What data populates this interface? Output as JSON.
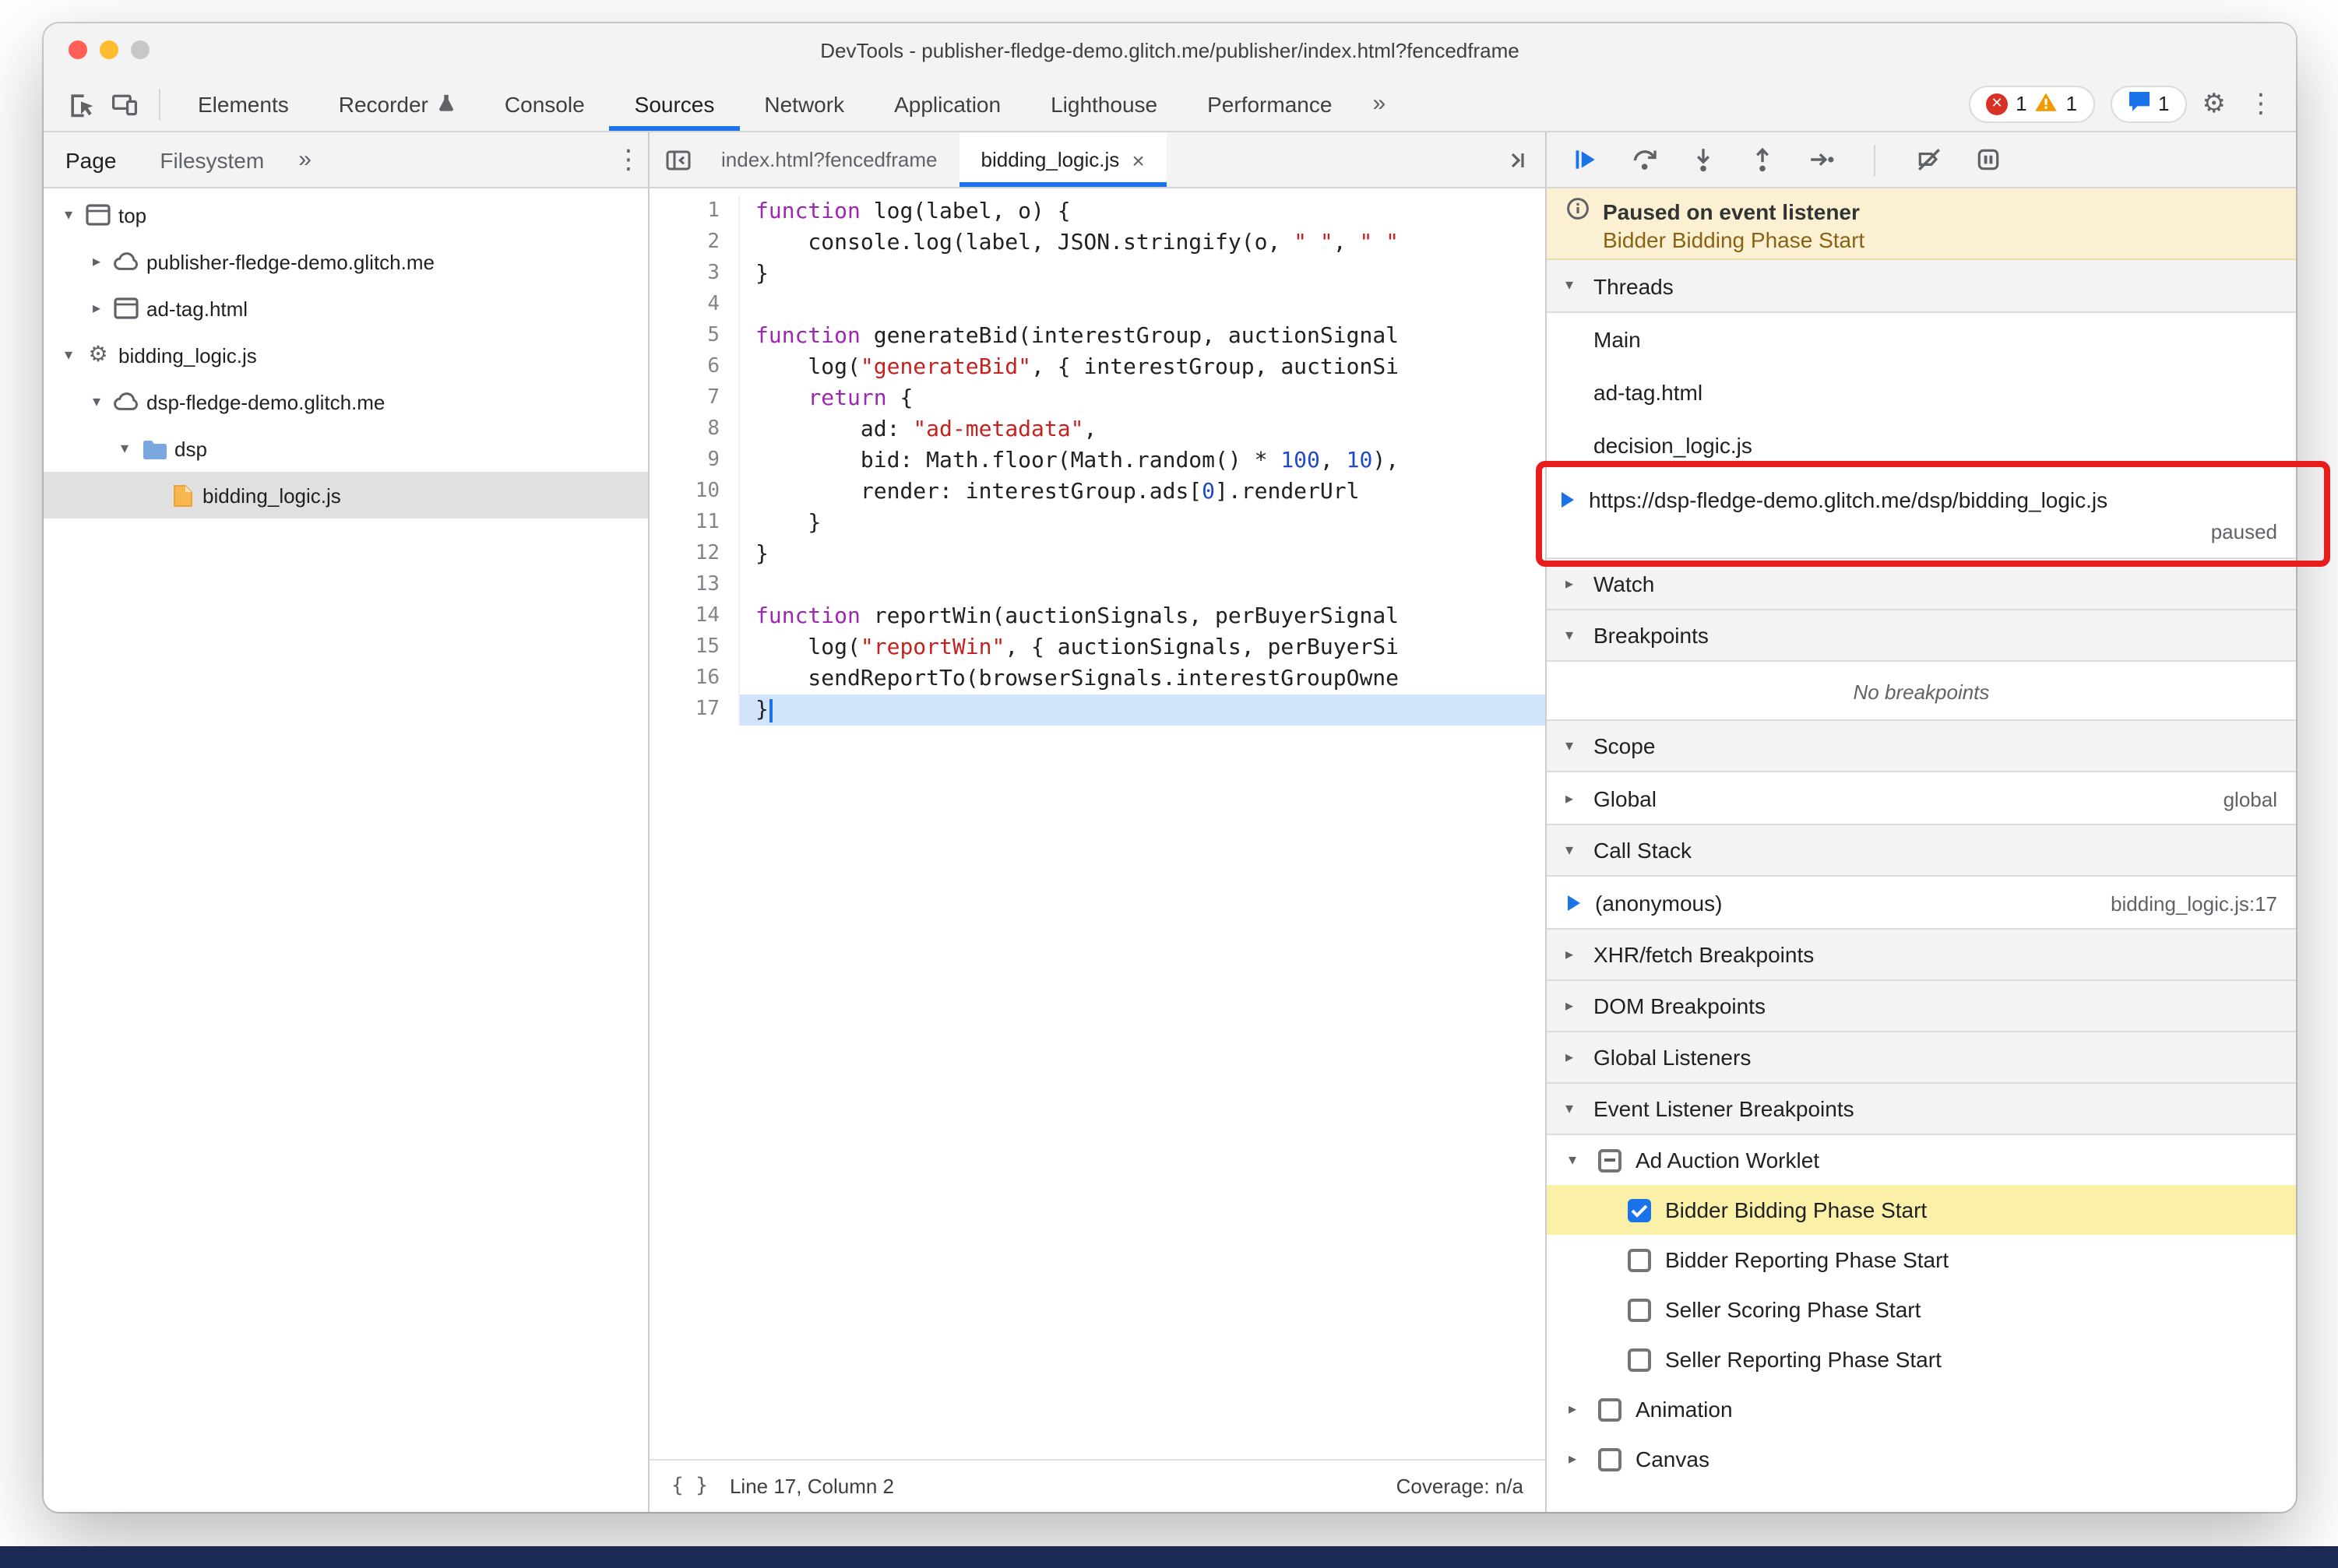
{
  "window": {
    "title": "DevTools - publisher-fledge-demo.glitch.me/publisher/index.html?fencedframe",
    "traffic_lights": [
      "#ff5f57",
      "#febc2e",
      "#c7c7c7"
    ]
  },
  "main_toolbar": {
    "tabs": [
      {
        "label": "Elements",
        "active": false
      },
      {
        "label": "Recorder",
        "active": false,
        "has_flask_icon": true
      },
      {
        "label": "Console",
        "active": false
      },
      {
        "label": "Sources",
        "active": true
      },
      {
        "label": "Network",
        "active": false
      },
      {
        "label": "Application",
        "active": false
      },
      {
        "label": "Lighthouse",
        "active": false
      },
      {
        "label": "Performance",
        "active": false
      }
    ],
    "more_tabs_chevron": "»",
    "badges": {
      "errors": "1",
      "warnings": "1",
      "issues": "1"
    }
  },
  "navigator": {
    "tabs": [
      {
        "label": "Page",
        "active": true
      },
      {
        "label": "Filesystem",
        "active": false
      }
    ],
    "more_tabs_chevron": "»",
    "tree": [
      {
        "label": "top",
        "depth": 0,
        "state": "expanded",
        "icon": "frame-icon"
      },
      {
        "label": "publisher-fledge-demo.glitch.me",
        "depth": 1,
        "state": "collapsed",
        "icon": "cloud-icon"
      },
      {
        "label": "ad-tag.html",
        "depth": 1,
        "state": "collapsed",
        "icon": "frame-icon"
      },
      {
        "label": "bidding_logic.js",
        "depth": 0,
        "state": "expanded",
        "icon": "worklet-gear-icon"
      },
      {
        "label": "dsp-fledge-demo.glitch.me",
        "depth": 1,
        "state": "expanded",
        "icon": "cloud-icon"
      },
      {
        "label": "dsp",
        "depth": 2,
        "state": "expanded",
        "icon": "folder-icon"
      },
      {
        "label": "bidding_logic.js",
        "depth": 3,
        "state": "leaf",
        "icon": "js-file-icon",
        "selected": true
      }
    ]
  },
  "editor": {
    "tabs": [
      {
        "label": "index.html?fencedframe",
        "active": false
      },
      {
        "label": "bidding_logic.js",
        "active": true,
        "close_glyph": "×"
      }
    ],
    "paused_line": 17,
    "code": [
      {
        "n": 1,
        "tokens": [
          [
            "kw",
            "function"
          ],
          [
            "pl",
            " log(label, o) {"
          ]
        ]
      },
      {
        "n": 2,
        "tokens": [
          [
            "pl",
            "    console.log(label, JSON.stringify(o, "
          ],
          [
            "str",
            "\" \""
          ],
          [
            "pl",
            ", "
          ],
          [
            "str",
            "\" \""
          ]
        ]
      },
      {
        "n": 3,
        "tokens": [
          [
            "pl",
            "}"
          ]
        ]
      },
      {
        "n": 4,
        "tokens": []
      },
      {
        "n": 5,
        "tokens": [
          [
            "kw",
            "function"
          ],
          [
            "pl",
            " generateBid(interestGroup, auctionSignal"
          ]
        ]
      },
      {
        "n": 6,
        "tokens": [
          [
            "pl",
            "    log("
          ],
          [
            "str",
            "\"generateBid\""
          ],
          [
            "pl",
            ", { interestGroup, auctionSi"
          ]
        ]
      },
      {
        "n": 7,
        "tokens": [
          [
            "pl",
            "    "
          ],
          [
            "kw",
            "return"
          ],
          [
            "pl",
            " {"
          ]
        ]
      },
      {
        "n": 8,
        "tokens": [
          [
            "pl",
            "        ad: "
          ],
          [
            "str",
            "\"ad-metadata\""
          ],
          [
            "pl",
            ","
          ]
        ]
      },
      {
        "n": 9,
        "tokens": [
          [
            "pl",
            "        bid: Math.floor(Math.random() * "
          ],
          [
            "num",
            "100"
          ],
          [
            "pl",
            ", "
          ],
          [
            "num",
            "10"
          ],
          [
            "pl",
            "),"
          ]
        ]
      },
      {
        "n": 10,
        "tokens": [
          [
            "pl",
            "        render: interestGroup.ads["
          ],
          [
            "num",
            "0"
          ],
          [
            "pl",
            "].renderUrl"
          ]
        ]
      },
      {
        "n": 11,
        "tokens": [
          [
            "pl",
            "    }"
          ]
        ]
      },
      {
        "n": 12,
        "tokens": [
          [
            "pl",
            "}"
          ]
        ]
      },
      {
        "n": 13,
        "tokens": []
      },
      {
        "n": 14,
        "tokens": [
          [
            "kw",
            "function"
          ],
          [
            "pl",
            " reportWin(auctionSignals, perBuyerSignal"
          ]
        ]
      },
      {
        "n": 15,
        "tokens": [
          [
            "pl",
            "    log("
          ],
          [
            "str",
            "\"reportWin\""
          ],
          [
            "pl",
            ", { auctionSignals, perBuyerSi"
          ]
        ]
      },
      {
        "n": 16,
        "tokens": [
          [
            "pl",
            "    sendReportTo(browserSignals.interestGroupOwne"
          ]
        ]
      },
      {
        "n": 17,
        "tokens": [
          [
            "pl",
            "}"
          ]
        ]
      }
    ],
    "status": {
      "position": "Line 17, Column 2",
      "coverage": "Coverage: n/a"
    }
  },
  "debugger": {
    "controls": [
      "resume",
      "step-over",
      "step-into",
      "step-out",
      "step",
      "deactivate-breakpoints",
      "pause-on-exceptions"
    ],
    "paused_banner": {
      "title": "Paused on event listener",
      "detail": "Bidder Bidding Phase Start"
    },
    "threads": {
      "title": "Threads",
      "items": [
        {
          "label": "Main"
        },
        {
          "label": "ad-tag.html"
        },
        {
          "label": "decision_logic.js"
        },
        {
          "label": "https://dsp-fledge-demo.glitch.me/dsp/bidding_logic.js",
          "status": "paused",
          "current": true
        }
      ]
    },
    "watch": {
      "title": "Watch"
    },
    "breakpoints": {
      "title": "Breakpoints",
      "empty_message": "No breakpoints"
    },
    "scope": {
      "title": "Scope",
      "rows": [
        {
          "label": "Global",
          "note": "global"
        }
      ]
    },
    "call_stack": {
      "title": "Call Stack",
      "rows": [
        {
          "label": "(anonymous)",
          "location": "bidding_logic.js:17",
          "current": true
        }
      ]
    },
    "collapsed_sections": [
      "XHR/fetch Breakpoints",
      "DOM Breakpoints",
      "Global Listeners"
    ],
    "event_listener_breakpoints": {
      "title": "Event Listener Breakpoints",
      "rows": [
        {
          "label": "Ad Auction Worklet",
          "type": "group",
          "state": "expanded",
          "checkbox": "indeterminate"
        },
        {
          "label": "Bidder Bidding Phase Start",
          "type": "child",
          "checkbox": "checked",
          "highlighted": true
        },
        {
          "label": "Bidder Reporting Phase Start",
          "type": "child",
          "checkbox": "unchecked"
        },
        {
          "label": "Seller Scoring Phase Start",
          "type": "child",
          "checkbox": "unchecked"
        },
        {
          "label": "Seller Reporting Phase Start",
          "type": "child",
          "checkbox": "unchecked"
        },
        {
          "label": "Animation",
          "type": "group",
          "state": "collapsed",
          "checkbox": "unchecked"
        },
        {
          "label": "Canvas",
          "type": "group",
          "state": "collapsed",
          "checkbox": "unchecked"
        }
      ]
    }
  },
  "annotation": {
    "shape": "rectangle",
    "color": "#e91c1c",
    "target": "paused bidding_logic.js thread"
  },
  "colors": {
    "accent_blue": "#1a73e8",
    "paused_banner_bg": "#fbf1d2",
    "paused_detail_text": "#8a6214",
    "execution_line_highlight": "#d2e3fc",
    "listener_highlight_yellow": "#fbf0a7",
    "selected_row_gray": "#e0e0e0",
    "keyword": "#9c27b0",
    "string": "#c5221f",
    "number": "#2049c9",
    "bottom_strip": "#1b2a52"
  }
}
